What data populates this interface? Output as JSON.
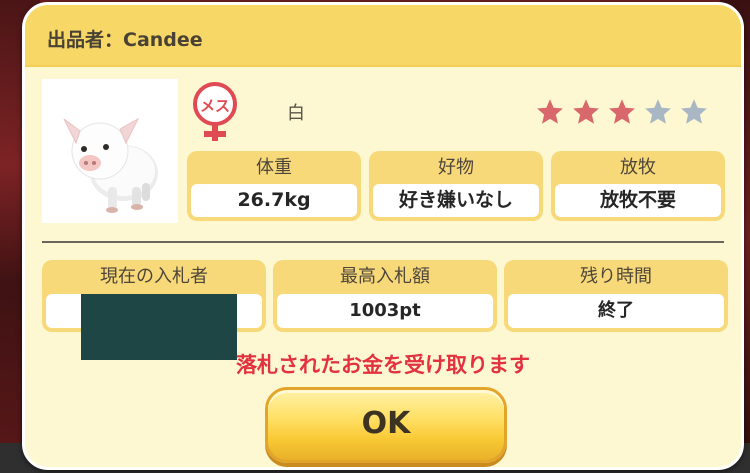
{
  "seller": {
    "label": "出品者：Candee"
  },
  "animal": {
    "image_icon": "pig-icon",
    "gender_badge": "メス",
    "gender_icon": "female-icon",
    "color": "白",
    "rating": 3,
    "rating_max": 5,
    "rating_color": "#d9686c",
    "rating_empty_color": "#a9b6c4"
  },
  "stats": [
    {
      "label": "体重",
      "value": "26.7kg"
    },
    {
      "label": "好物",
      "value": "好き嫌いなし"
    },
    {
      "label": "放牧",
      "value": "放牧不要"
    }
  ],
  "bid": [
    {
      "label": "現在の入札者",
      "value": ""
    },
    {
      "label": "最高入札額",
      "value": "1003pt"
    },
    {
      "label": "残り時間",
      "value": "終了"
    }
  ],
  "notice": "落札されたお金を受け取ります",
  "ok_button": "OK",
  "colors": {
    "header": "#f7d766",
    "panel": "#fdf8d2",
    "card": "#f7d97a",
    "notice": "#e2323f",
    "badge": "#e04a52"
  }
}
